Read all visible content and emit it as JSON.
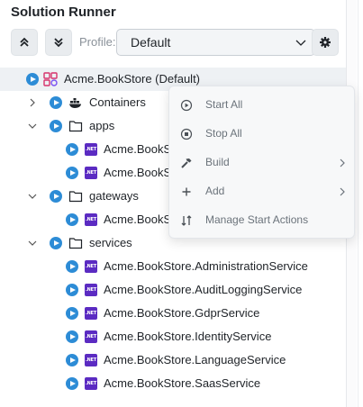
{
  "panel": {
    "title": "Solution Runner"
  },
  "toolbar": {
    "collapse_all_icon": "double-chevron-up-icon",
    "expand_all_icon": "double-chevron-down-icon",
    "profile_label": "Profile:",
    "profile_value": "Default",
    "settings_icon": "gear-icon"
  },
  "tree": {
    "root": {
      "label": "Acme.BookStore (Default)",
      "icon": "solution-icon"
    },
    "containers": {
      "label": "Containers",
      "icon": "docker-icon"
    },
    "apps": {
      "label": "apps",
      "items": [
        {
          "label": "Acme.BookS"
        },
        {
          "label": "Acme.BookS"
        }
      ]
    },
    "gateways": {
      "label": "gateways",
      "items": [
        {
          "label": "Acme.BookS"
        }
      ]
    },
    "services": {
      "label": "services",
      "items": [
        {
          "label": "Acme.BookStore.AdministrationService"
        },
        {
          "label": "Acme.BookStore.AuditLoggingService"
        },
        {
          "label": "Acme.BookStore.GdprService"
        },
        {
          "label": "Acme.BookStore.IdentityService"
        },
        {
          "label": "Acme.BookStore.LanguageService"
        },
        {
          "label": "Acme.BookStore.SaasService"
        }
      ]
    },
    "net_badge": ".NET"
  },
  "context_menu": {
    "items": [
      {
        "label": "Start All",
        "icon": "play-circle-icon"
      },
      {
        "label": "Stop All",
        "icon": "stop-circle-icon"
      },
      {
        "label": "Build",
        "icon": "hammer-icon",
        "submenu": true
      },
      {
        "label": "Add",
        "icon": "plus-icon",
        "submenu": true
      },
      {
        "label": "Manage Start Actions",
        "icon": "sort-icon"
      }
    ]
  }
}
